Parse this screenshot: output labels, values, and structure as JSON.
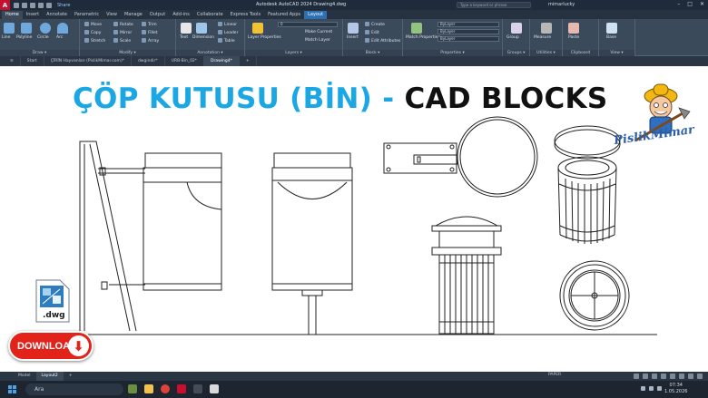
{
  "titlebar": {
    "app_logo": "A",
    "share": "Share",
    "title": "Autodesk AutoCAD 2024   Drawing4.dwg",
    "search_placeholder": "Type a keyword or phrase",
    "user": "mimarlucky"
  },
  "ribbon_tabs": [
    "Home",
    "Insert",
    "Annotate",
    "Parametric",
    "View",
    "Manage",
    "Output",
    "Add-ins",
    "Collaborate",
    "Express Tools",
    "Featured Apps",
    "Layout"
  ],
  "ribbon": {
    "draw": {
      "caption": "Draw ▾",
      "tools": [
        "Line",
        "Polyline",
        "Circle",
        "Arc"
      ]
    },
    "modify": {
      "caption": "Modify ▾",
      "tools": [
        "Move",
        "Rotate",
        "Trim",
        "Copy",
        "Mirror",
        "Fillet",
        "Stretch",
        "Scale",
        "Array"
      ]
    },
    "annotation": {
      "caption": "Annotation ▾",
      "tools": [
        "Text",
        "Dimension",
        "Linear",
        "Leader",
        "Table"
      ]
    },
    "layers": {
      "caption": "Layers ▾",
      "tools": [
        "Layer Properties",
        "Make Current",
        "Match Layer"
      ],
      "layer_value": "0"
    },
    "block": {
      "caption": "Block ▾",
      "tools": [
        "Insert",
        "Create",
        "Edit",
        "Edit Attributes"
      ]
    },
    "properties": {
      "caption": "Properties ▾",
      "tools": [
        "Match Properties"
      ],
      "values": [
        "ByLayer",
        "ByLayer",
        "ByLayer"
      ]
    },
    "groups": {
      "caption": "Groups ▾",
      "tools": [
        "Group"
      ]
    },
    "utilities": {
      "caption": "Utilities ▾",
      "tools": [
        "Measure"
      ]
    },
    "clipboard": {
      "caption": "Clipboard",
      "tools": [
        "Paste"
      ]
    },
    "view": {
      "caption": "View ▾",
      "tools": [
        "Base"
      ]
    }
  },
  "doc_tabs": [
    "Start",
    "ÇİRİN Hayvanları (PislikMimar.com)*",
    "dwgindir*",
    "URB-Bin_02*",
    "Drawing4*"
  ],
  "headline": {
    "part1": "ÇÖP KUTUSU (BİN) - ",
    "part2": "CAD BLOCKS"
  },
  "brand_text": "PislikMimar",
  "dwg_label": ".dwg",
  "download_label": "DOWNLOAD",
  "layout_tabs": [
    "Model",
    "Layout2"
  ],
  "status": {
    "paper": "PAPER"
  },
  "taskbar": {
    "search_placeholder": "Ara",
    "time": "07:34",
    "date": "1.05.2026"
  },
  "colors": {
    "accent_cyan": "#1aa7e3",
    "download_red": "#e2231a",
    "brand_blue": "#2d5ea8"
  }
}
